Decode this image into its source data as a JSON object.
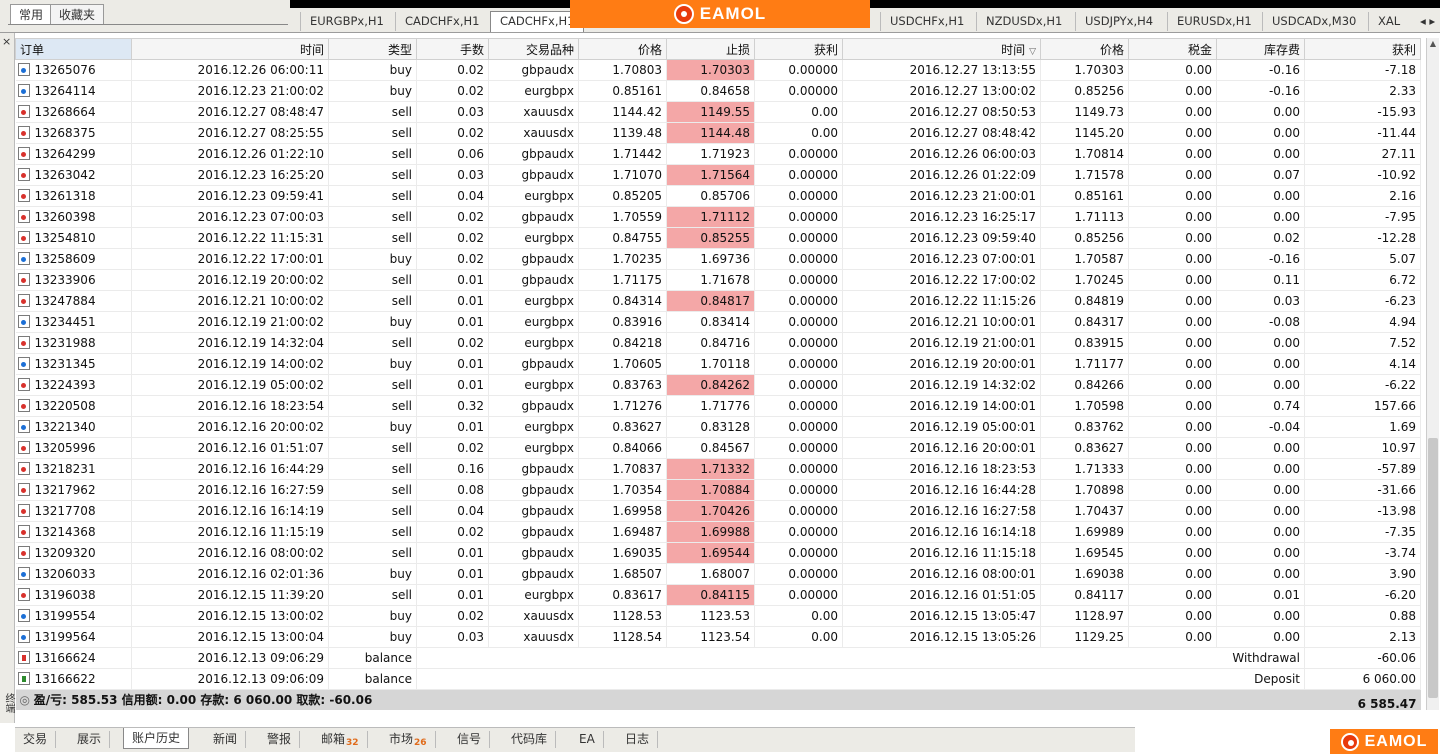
{
  "nav_tabs": [
    "常用",
    "收藏夹"
  ],
  "chart_tabs": [
    "EURGBPx,H1",
    "CADCHFx,H1",
    "CADCHFx,H1",
    "USDCHFx,H1",
    "NZDUSDx,H1",
    "USDJPYx,H4",
    "EURUSDx,H1",
    "USDCADx,M30",
    "XAL"
  ],
  "brand": {
    "name": "EAMOL"
  },
  "close_label": "×",
  "side_label": "终端",
  "columns": [
    "订单",
    "时间",
    "类型",
    "手数",
    "交易品种",
    "价格",
    "止损",
    "获利",
    "时间",
    "价格",
    "税金",
    "库存费",
    "获利"
  ],
  "rows": [
    {
      "order": "13265076",
      "open_time": "2016.12.26 06:00:11",
      "type": "buy",
      "lots": "0.02",
      "symbol": "gbpaudx",
      "open_price": "1.70803",
      "sl": "1.70303",
      "tp": "0.00000",
      "close_time": "2016.12.27 13:13:55",
      "close_price": "1.70303",
      "tax": "0.00",
      "swap": "-0.16",
      "profit": "-7.18",
      "sl_hit": true
    },
    {
      "order": "13264114",
      "open_time": "2016.12.23 21:00:02",
      "type": "buy",
      "lots": "0.02",
      "symbol": "eurgbpx",
      "open_price": "0.85161",
      "sl": "0.84658",
      "tp": "0.00000",
      "close_time": "2016.12.27 13:00:02",
      "close_price": "0.85256",
      "tax": "0.00",
      "swap": "-0.16",
      "profit": "2.33",
      "sl_hit": false
    },
    {
      "order": "13268664",
      "open_time": "2016.12.27 08:48:47",
      "type": "sell",
      "lots": "0.03",
      "symbol": "xauusdx",
      "open_price": "1144.42",
      "sl": "1149.55",
      "tp": "0.00",
      "close_time": "2016.12.27 08:50:53",
      "close_price": "1149.73",
      "tax": "0.00",
      "swap": "0.00",
      "profit": "-15.93",
      "sl_hit": true
    },
    {
      "order": "13268375",
      "open_time": "2016.12.27 08:25:55",
      "type": "sell",
      "lots": "0.02",
      "symbol": "xauusdx",
      "open_price": "1139.48",
      "sl": "1144.48",
      "tp": "0.00",
      "close_time": "2016.12.27 08:48:42",
      "close_price": "1145.20",
      "tax": "0.00",
      "swap": "0.00",
      "profit": "-11.44",
      "sl_hit": true
    },
    {
      "order": "13264299",
      "open_time": "2016.12.26 01:22:10",
      "type": "sell",
      "lots": "0.06",
      "symbol": "gbpaudx",
      "open_price": "1.71442",
      "sl": "1.71923",
      "tp": "0.00000",
      "close_time": "2016.12.26 06:00:03",
      "close_price": "1.70814",
      "tax": "0.00",
      "swap": "0.00",
      "profit": "27.11",
      "sl_hit": false
    },
    {
      "order": "13263042",
      "open_time": "2016.12.23 16:25:20",
      "type": "sell",
      "lots": "0.03",
      "symbol": "gbpaudx",
      "open_price": "1.71070",
      "sl": "1.71564",
      "tp": "0.00000",
      "close_time": "2016.12.26 01:22:09",
      "close_price": "1.71578",
      "tax": "0.00",
      "swap": "0.07",
      "profit": "-10.92",
      "sl_hit": true
    },
    {
      "order": "13261318",
      "open_time": "2016.12.23 09:59:41",
      "type": "sell",
      "lots": "0.04",
      "symbol": "eurgbpx",
      "open_price": "0.85205",
      "sl": "0.85706",
      "tp": "0.00000",
      "close_time": "2016.12.23 21:00:01",
      "close_price": "0.85161",
      "tax": "0.00",
      "swap": "0.00",
      "profit": "2.16",
      "sl_hit": false
    },
    {
      "order": "13260398",
      "open_time": "2016.12.23 07:00:03",
      "type": "sell",
      "lots": "0.02",
      "symbol": "gbpaudx",
      "open_price": "1.70559",
      "sl": "1.71112",
      "tp": "0.00000",
      "close_time": "2016.12.23 16:25:17",
      "close_price": "1.71113",
      "tax": "0.00",
      "swap": "0.00",
      "profit": "-7.95",
      "sl_hit": true
    },
    {
      "order": "13254810",
      "open_time": "2016.12.22 11:15:31",
      "type": "sell",
      "lots": "0.02",
      "symbol": "eurgbpx",
      "open_price": "0.84755",
      "sl": "0.85255",
      "tp": "0.00000",
      "close_time": "2016.12.23 09:59:40",
      "close_price": "0.85256",
      "tax": "0.00",
      "swap": "0.02",
      "profit": "-12.28",
      "sl_hit": true
    },
    {
      "order": "13258609",
      "open_time": "2016.12.22 17:00:01",
      "type": "buy",
      "lots": "0.02",
      "symbol": "gbpaudx",
      "open_price": "1.70235",
      "sl": "1.69736",
      "tp": "0.00000",
      "close_time": "2016.12.23 07:00:01",
      "close_price": "1.70587",
      "tax": "0.00",
      "swap": "-0.16",
      "profit": "5.07",
      "sl_hit": false
    },
    {
      "order": "13233906",
      "open_time": "2016.12.19 20:00:02",
      "type": "sell",
      "lots": "0.01",
      "symbol": "gbpaudx",
      "open_price": "1.71175",
      "sl": "1.71678",
      "tp": "0.00000",
      "close_time": "2016.12.22 17:00:02",
      "close_price": "1.70245",
      "tax": "0.00",
      "swap": "0.11",
      "profit": "6.72",
      "sl_hit": false
    },
    {
      "order": "13247884",
      "open_time": "2016.12.21 10:00:02",
      "type": "sell",
      "lots": "0.01",
      "symbol": "eurgbpx",
      "open_price": "0.84314",
      "sl": "0.84817",
      "tp": "0.00000",
      "close_time": "2016.12.22 11:15:26",
      "close_price": "0.84819",
      "tax": "0.00",
      "swap": "0.03",
      "profit": "-6.23",
      "sl_hit": true
    },
    {
      "order": "13234451",
      "open_time": "2016.12.19 21:00:02",
      "type": "buy",
      "lots": "0.01",
      "symbol": "eurgbpx",
      "open_price": "0.83916",
      "sl": "0.83414",
      "tp": "0.00000",
      "close_time": "2016.12.21 10:00:01",
      "close_price": "0.84317",
      "tax": "0.00",
      "swap": "-0.08",
      "profit": "4.94",
      "sl_hit": false
    },
    {
      "order": "13231988",
      "open_time": "2016.12.19 14:32:04",
      "type": "sell",
      "lots": "0.02",
      "symbol": "eurgbpx",
      "open_price": "0.84218",
      "sl": "0.84716",
      "tp": "0.00000",
      "close_time": "2016.12.19 21:00:01",
      "close_price": "0.83915",
      "tax": "0.00",
      "swap": "0.00",
      "profit": "7.52",
      "sl_hit": false
    },
    {
      "order": "13231345",
      "open_time": "2016.12.19 14:00:02",
      "type": "buy",
      "lots": "0.01",
      "symbol": "gbpaudx",
      "open_price": "1.70605",
      "sl": "1.70118",
      "tp": "0.00000",
      "close_time": "2016.12.19 20:00:01",
      "close_price": "1.71177",
      "tax": "0.00",
      "swap": "0.00",
      "profit": "4.14",
      "sl_hit": false
    },
    {
      "order": "13224393",
      "open_time": "2016.12.19 05:00:02",
      "type": "sell",
      "lots": "0.01",
      "symbol": "eurgbpx",
      "open_price": "0.83763",
      "sl": "0.84262",
      "tp": "0.00000",
      "close_time": "2016.12.19 14:32:02",
      "close_price": "0.84266",
      "tax": "0.00",
      "swap": "0.00",
      "profit": "-6.22",
      "sl_hit": true
    },
    {
      "order": "13220508",
      "open_time": "2016.12.16 18:23:54",
      "type": "sell",
      "lots": "0.32",
      "symbol": "gbpaudx",
      "open_price": "1.71276",
      "sl": "1.71776",
      "tp": "0.00000",
      "close_time": "2016.12.19 14:00:01",
      "close_price": "1.70598",
      "tax": "0.00",
      "swap": "0.74",
      "profit": "157.66",
      "sl_hit": false
    },
    {
      "order": "13221340",
      "open_time": "2016.12.16 20:00:02",
      "type": "buy",
      "lots": "0.01",
      "symbol": "eurgbpx",
      "open_price": "0.83627",
      "sl": "0.83128",
      "tp": "0.00000",
      "close_time": "2016.12.19 05:00:01",
      "close_price": "0.83762",
      "tax": "0.00",
      "swap": "-0.04",
      "profit": "1.69",
      "sl_hit": false
    },
    {
      "order": "13205996",
      "open_time": "2016.12.16 01:51:07",
      "type": "sell",
      "lots": "0.02",
      "symbol": "eurgbpx",
      "open_price": "0.84066",
      "sl": "0.84567",
      "tp": "0.00000",
      "close_time": "2016.12.16 20:00:01",
      "close_price": "0.83627",
      "tax": "0.00",
      "swap": "0.00",
      "profit": "10.97",
      "sl_hit": false
    },
    {
      "order": "13218231",
      "open_time": "2016.12.16 16:44:29",
      "type": "sell",
      "lots": "0.16",
      "symbol": "gbpaudx",
      "open_price": "1.70837",
      "sl": "1.71332",
      "tp": "0.00000",
      "close_time": "2016.12.16 18:23:53",
      "close_price": "1.71333",
      "tax": "0.00",
      "swap": "0.00",
      "profit": "-57.89",
      "sl_hit": true
    },
    {
      "order": "13217962",
      "open_time": "2016.12.16 16:27:59",
      "type": "sell",
      "lots": "0.08",
      "symbol": "gbpaudx",
      "open_price": "1.70354",
      "sl": "1.70884",
      "tp": "0.00000",
      "close_time": "2016.12.16 16:44:28",
      "close_price": "1.70898",
      "tax": "0.00",
      "swap": "0.00",
      "profit": "-31.66",
      "sl_hit": true
    },
    {
      "order": "13217708",
      "open_time": "2016.12.16 16:14:19",
      "type": "sell",
      "lots": "0.04",
      "symbol": "gbpaudx",
      "open_price": "1.69958",
      "sl": "1.70426",
      "tp": "0.00000",
      "close_time": "2016.12.16 16:27:58",
      "close_price": "1.70437",
      "tax": "0.00",
      "swap": "0.00",
      "profit": "-13.98",
      "sl_hit": true
    },
    {
      "order": "13214368",
      "open_time": "2016.12.16 11:15:19",
      "type": "sell",
      "lots": "0.02",
      "symbol": "gbpaudx",
      "open_price": "1.69487",
      "sl": "1.69988",
      "tp": "0.00000",
      "close_time": "2016.12.16 16:14:18",
      "close_price": "1.69989",
      "tax": "0.00",
      "swap": "0.00",
      "profit": "-7.35",
      "sl_hit": true
    },
    {
      "order": "13209320",
      "open_time": "2016.12.16 08:00:02",
      "type": "sell",
      "lots": "0.01",
      "symbol": "gbpaudx",
      "open_price": "1.69035",
      "sl": "1.69544",
      "tp": "0.00000",
      "close_time": "2016.12.16 11:15:18",
      "close_price": "1.69545",
      "tax": "0.00",
      "swap": "0.00",
      "profit": "-3.74",
      "sl_hit": true
    },
    {
      "order": "13206033",
      "open_time": "2016.12.16 02:01:36",
      "type": "buy",
      "lots": "0.01",
      "symbol": "gbpaudx",
      "open_price": "1.68507",
      "sl": "1.68007",
      "tp": "0.00000",
      "close_time": "2016.12.16 08:00:01",
      "close_price": "1.69038",
      "tax": "0.00",
      "swap": "0.00",
      "profit": "3.90",
      "sl_hit": false
    },
    {
      "order": "13196038",
      "open_time": "2016.12.15 11:39:20",
      "type": "sell",
      "lots": "0.01",
      "symbol": "eurgbpx",
      "open_price": "0.83617",
      "sl": "0.84115",
      "tp": "0.00000",
      "close_time": "2016.12.16 01:51:05",
      "close_price": "0.84117",
      "tax": "0.00",
      "swap": "0.01",
      "profit": "-6.20",
      "sl_hit": true
    },
    {
      "order": "13199554",
      "open_time": "2016.12.15 13:00:02",
      "type": "buy",
      "lots": "0.02",
      "symbol": "xauusdx",
      "open_price": "1128.53",
      "sl": "1123.53",
      "tp": "0.00",
      "close_time": "2016.12.15 13:05:47",
      "close_price": "1128.97",
      "tax": "0.00",
      "swap": "0.00",
      "profit": "0.88",
      "sl_hit": false
    },
    {
      "order": "13199564",
      "open_time": "2016.12.15 13:00:04",
      "type": "buy",
      "lots": "0.03",
      "symbol": "xauusdx",
      "open_price": "1128.54",
      "sl": "1123.54",
      "tp": "0.00",
      "close_time": "2016.12.15 13:05:26",
      "close_price": "1129.25",
      "tax": "0.00",
      "swap": "0.00",
      "profit": "2.13",
      "sl_hit": false
    }
  ],
  "balance_rows": [
    {
      "order": "13166624",
      "time": "2016.12.13 09:06:29",
      "type": "balance",
      "comment": "Withdrawal",
      "profit": "-60.06",
      "kind": "withdrawal"
    },
    {
      "order": "13166622",
      "time": "2016.12.13 09:06:09",
      "type": "balance",
      "comment": "Deposit",
      "profit": "6 060.00",
      "kind": "deposit"
    }
  ],
  "summary": {
    "text": "盈/亏: 585.53  信用额: 0.00  存款: 6 060.00  取款: -60.06",
    "total": "6 585.47"
  },
  "bottom_tabs": [
    {
      "label": "交易",
      "badge": ""
    },
    {
      "label": "展示",
      "badge": ""
    },
    {
      "label": "账户历史",
      "badge": ""
    },
    {
      "label": "新闻",
      "badge": ""
    },
    {
      "label": "警报",
      "badge": ""
    },
    {
      "label": "邮箱",
      "badge": "32"
    },
    {
      "label": "市场",
      "badge": "26"
    },
    {
      "label": "信号",
      "badge": ""
    },
    {
      "label": "代码库",
      "badge": ""
    },
    {
      "label": "EA",
      "badge": ""
    },
    {
      "label": "日志",
      "badge": ""
    }
  ],
  "active_bottom_tab": 2,
  "colors": {
    "brand_orange": "#ff7c14",
    "sl_highlight": "#f4a7a7",
    "buy_icon": "#1c6fd6",
    "sell_icon": "#d8312c"
  }
}
